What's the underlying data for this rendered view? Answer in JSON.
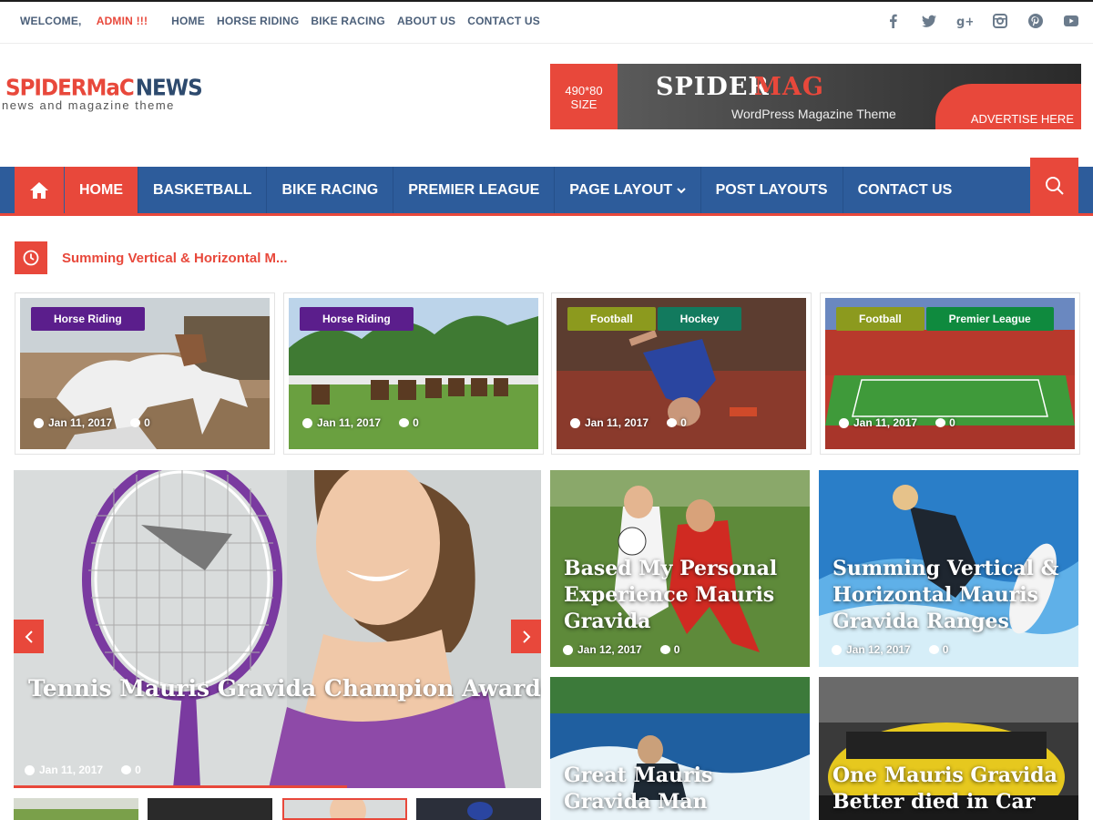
{
  "topbar": {
    "welcome": "WELCOME,",
    "admin": "ADMIN !!!",
    "links": [
      "HOME",
      "HORSE RIDING",
      "BIKE RACING",
      "ABOUT US",
      "CONTACT US"
    ],
    "social_icons": [
      "facebook-icon",
      "twitter-icon",
      "google-plus-icon",
      "instagram-icon",
      "pinterest-icon",
      "youtube-icon"
    ]
  },
  "header": {
    "logo_part1": "SPIDERMaC",
    "logo_part2": "NEWS",
    "tagline": "news and magazine theme",
    "ad": {
      "size_line1": "490*80",
      "size_line2": "SIZE",
      "brand_white": "SPIDER",
      "brand_red": "MAG",
      "subtitle": "WordPress Magazine Theme",
      "cta": "ADVERTISE HERE"
    }
  },
  "nav": {
    "items": [
      "HOME",
      "BASKETBALL",
      "BIKE RACING",
      "PREMIER LEAGUE",
      "PAGE LAYOUT",
      "POST LAYOUTS",
      "CONTACT US"
    ],
    "active": "HOME",
    "dropdown_item": "PAGE LAYOUT"
  },
  "ticker": {
    "text": "Summing Vertical & Horizontal M..."
  },
  "small_cards": [
    {
      "cats": [
        "Horse Riding"
      ],
      "date": "Jan 11, 2017",
      "comments": "0"
    },
    {
      "cats": [
        "Horse Riding"
      ],
      "date": "Jan 11, 2017",
      "comments": "0"
    },
    {
      "cats": [
        "Football",
        "Hockey"
      ],
      "date": "Jan 11, 2017",
      "comments": "0"
    },
    {
      "cats": [
        "Football",
        "Premier League"
      ],
      "date": "Jan 11, 2017",
      "comments": "0"
    }
  ],
  "slider": {
    "title": "Tennis Mauris Gravida Champion Awarded",
    "date": "Jan 11, 2017",
    "comments": "0",
    "prev_label": "‹",
    "next_label": "›"
  },
  "grid_cards": [
    {
      "title": "Based My Personal Experience Mauris Gravida",
      "date": "Jan 12, 2017",
      "comments": "0"
    },
    {
      "title": "Summing Vertical & Horizontal Mauris Gravida Ranges",
      "date": "Jan 12, 2017",
      "comments": "0"
    },
    {
      "title": "Great Mauris Gravida Man",
      "date": "",
      "comments": ""
    },
    {
      "title": "One Mauris Gravida Better died in Car",
      "date": "",
      "comments": ""
    }
  ],
  "colors": {
    "accent": "#e8483b",
    "nav_blue": "#2d5c9b",
    "purple_tag": "#5b1e8c",
    "olive_tag": "#8c9a1e",
    "teal_tag": "#127a5e",
    "green_tag": "#0f8a3e"
  }
}
